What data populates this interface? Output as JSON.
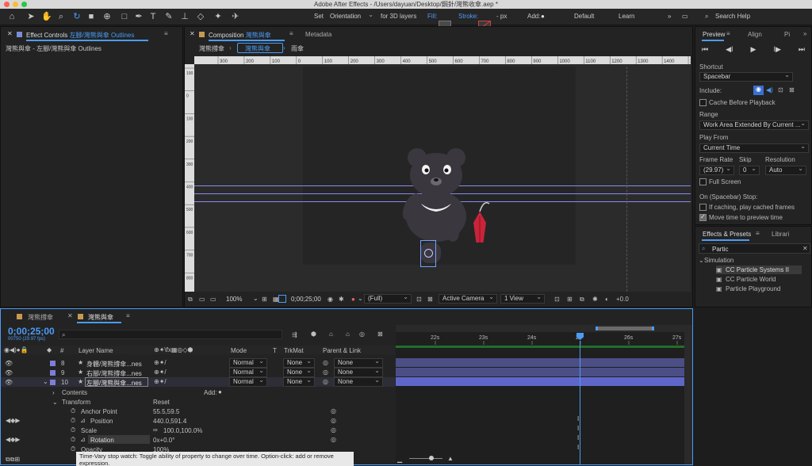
{
  "window": {
    "title": "Adobe After Effects - /Users/dayuan/Desktop/鋼針/灣熊收傘.aep *"
  },
  "toolbar": {
    "set_label": "Set",
    "orientation_value": "Orientation",
    "for3d_label": "for 3D layers",
    "fill_label": "Fill:",
    "stroke_label": "Stroke:",
    "px_label": "- px",
    "add_label": "Add:",
    "workspace_default": "Default",
    "workspace_learn": "Learn",
    "search_placeholder": "Search Help"
  },
  "effect_controls": {
    "tab_label": "Effect Controls",
    "tab_layer": "左腳/灣熊與傘 Outlines",
    "header": "灣熊與傘 - 左腳/灣熊與傘 Outlines"
  },
  "composition": {
    "tab_label": "Composition",
    "tab_name": "灣熊與傘",
    "metadata_tab": "Metadata",
    "breadcrumbs": [
      "灣熊撐傘",
      "灣熊與傘",
      "雨傘"
    ],
    "ruler_top": [
      "300",
      "200",
      "100",
      "0",
      "100",
      "200",
      "300",
      "400",
      "500",
      "600",
      "700",
      "800",
      "900",
      "1000",
      "1100",
      "1200",
      "1300",
      "1400",
      "150"
    ],
    "ruler_left": [
      "100",
      "0",
      "100",
      "200",
      "300",
      "400",
      "500",
      "600",
      "700",
      "800"
    ],
    "footer": {
      "zoom": "100%",
      "timecode": "0;00;25;00",
      "quality": "(Full)",
      "camera": "Active Camera",
      "views": "1 View",
      "exposure": "+0.0"
    }
  },
  "preview": {
    "tabs": [
      "Preview",
      "Align",
      "Pi"
    ],
    "shortcut_label": "Shortcut",
    "shortcut_value": "Spacebar",
    "include_label": "Include:",
    "cache_label": "Cache Before Playback",
    "range_label": "Range",
    "range_value": "Work Area Extended By Current ...",
    "playfrom_label": "Play From",
    "playfrom_value": "Current Time",
    "framerate_label": "Frame Rate",
    "skip_label": "Skip",
    "resolution_label": "Resolution",
    "framerate_value": "(29.97)",
    "skip_value": "0",
    "resolution_value": "Auto",
    "fullscreen_label": "Full Screen",
    "onstop_label": "On (Spacebar) Stop:",
    "ifcaching_label": "If caching, play cached frames",
    "movetime_label": "Move time to preview time"
  },
  "effects_presets": {
    "tabs": [
      "Effects & Presets",
      "Librari"
    ],
    "search_value": "Partic",
    "category": "Simulation",
    "items": [
      "CC Particle Systems II",
      "CC Particle World",
      "Particle Playground"
    ]
  },
  "timeline": {
    "tabs": [
      "灣熊撐傘",
      "灣熊與傘"
    ],
    "timecode": "0;00;25;00",
    "frame_info": "00750 (29.97 fps)",
    "columns": {
      "num": "#",
      "layer_name": "Layer Name",
      "mode": "Mode",
      "t": "T",
      "trkmat": "TrkMat",
      "parent": "Parent & Link"
    },
    "ruler": [
      "22s",
      "23s",
      "24s",
      "2s",
      "26s",
      "27s"
    ],
    "layers": [
      {
        "num": "8",
        "name": "身體/灣熊撐傘...nes",
        "mode": "Normal",
        "trkmat": "None",
        "parent": "None",
        "color": "#7d7fd6"
      },
      {
        "num": "9",
        "name": "右腳/灣熊撐傘...nes",
        "mode": "Normal",
        "trkmat": "None",
        "parent": "None",
        "color": "#7d7fd6"
      },
      {
        "num": "10",
        "name": "左腳/灣熊與傘...nes",
        "mode": "Normal",
        "trkmat": "None",
        "parent": "None",
        "color": "#7d7fd6"
      }
    ],
    "properties": {
      "contents": "Contents",
      "add_label": "Add:",
      "transform": "Transform",
      "reset": "Reset",
      "anchor_label": "Anchor Point",
      "anchor_value": "55.5,59.5",
      "position_label": "Position",
      "position_value": "440.0,591.4",
      "scale_label": "Scale",
      "scale_value": "100.0,100.0%",
      "rotation_label": "Rotation",
      "rotation_value": "0x+0.0°",
      "opacity_label": "Opacity",
      "opacity_value": "100%"
    },
    "tooltip": "Time-Vary stop watch: Toggle ability of property to change over time. Option-click: add or remove expression."
  },
  "colors": {
    "accent": "#4b9cf5",
    "layer_label": "#7d7fd6",
    "umbrella": "#c8243a",
    "bear": "#3a383e"
  }
}
